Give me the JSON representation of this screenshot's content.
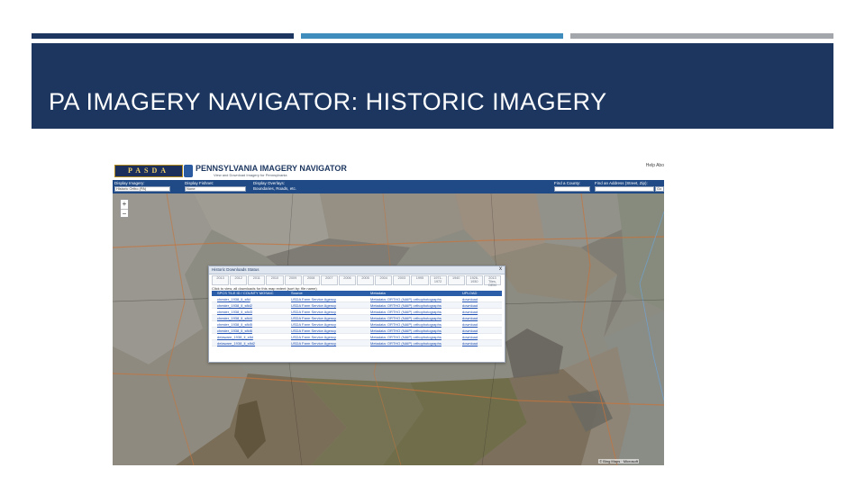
{
  "slide": {
    "title": "PA IMAGERY NAVIGATOR: HISTORIC IMAGERY"
  },
  "colors": {
    "banner": "#1c365f",
    "bar_dark": "#1c365f",
    "bar_blue": "#3f8dbc",
    "bar_gray": "#a3a6aa",
    "app_toolbar": "#1f4a86"
  },
  "app": {
    "logo_text": "PASDA",
    "title": "PENNSYLVANIA IMAGERY NAVIGATOR",
    "subtitle": "View and Download Imagery for Pennsylvania",
    "header_links": "Help  Abo",
    "toolbar": {
      "display_imagery_label": "Display Imagery:",
      "display_imagery_value": "Historic Ortho (PA)",
      "display_fishnet_label": "Display Fishnet:",
      "display_fishnet_value": "None",
      "display_overlays_label": "Display Overlays:",
      "display_overlays_value": "Boundaries, Roads, etc.",
      "find_county_label": "Find a County:",
      "find_address_label": "Find an Address (Street, Zip):",
      "go_label": "Go"
    },
    "zoom": {
      "in": "+",
      "out": "−"
    },
    "attribution": "© Bing Maps · Microsoft"
  },
  "dialog": {
    "title": "Historic Downloads Status",
    "close": "x",
    "years": [
      "2013",
      "2012",
      "2011",
      "2010",
      "2009",
      "2008",
      "2007",
      "2006",
      "2005",
      "2004",
      "2003",
      "1995",
      "1971-1972",
      "1940",
      "1926-1930",
      "2013 Tiles, DEM"
    ],
    "note": "Click to view, all downloads for this map extent (sort by: file name)",
    "columns": [
      "SPCS TILE ID / COUNTY MOSAIC",
      "Source",
      "Metadata",
      "UPLOAD"
    ],
    "rows": [
      [
        "chester_1938_ll_sfld",
        "USDA Farm Service Agency",
        "Metadata: ORTHO (NAIP) orthophotographs",
        "download"
      ],
      [
        "chester_1938_ll_sfld2",
        "USDA Farm Service Agency",
        "Metadata: ORTHO (NAIP) orthophotographs",
        "download"
      ],
      [
        "chester_1938_ll_sfld3",
        "USDA Farm Service Agency",
        "Metadata: ORTHO (NAIP) orthophotographs",
        "download"
      ],
      [
        "chester_1938_ll_sfld4",
        "USDA Farm Service Agency",
        "Metadata: ORTHO (NAIP) orthophotographs",
        "download"
      ],
      [
        "chester_1938_ll_sfld5",
        "USDA Farm Service Agency",
        "Metadata: ORTHO (NAIP) orthophotographs",
        "download"
      ],
      [
        "chester_1938_ll_sfld6",
        "USDA Farm Service Agency",
        "Metadata: ORTHO (NAIP) orthophotographs",
        "download"
      ],
      [
        "delaware_1938_ll_sfld",
        "USDA Farm Service Agency",
        "Metadata: ORTHO (NAIP) orthophotographs",
        "download"
      ],
      [
        "delaware_1938_ll_sfld2",
        "USDA Farm Service Agency",
        "Metadata: ORTHO (NAIP) orthophotographs",
        "download"
      ]
    ]
  }
}
